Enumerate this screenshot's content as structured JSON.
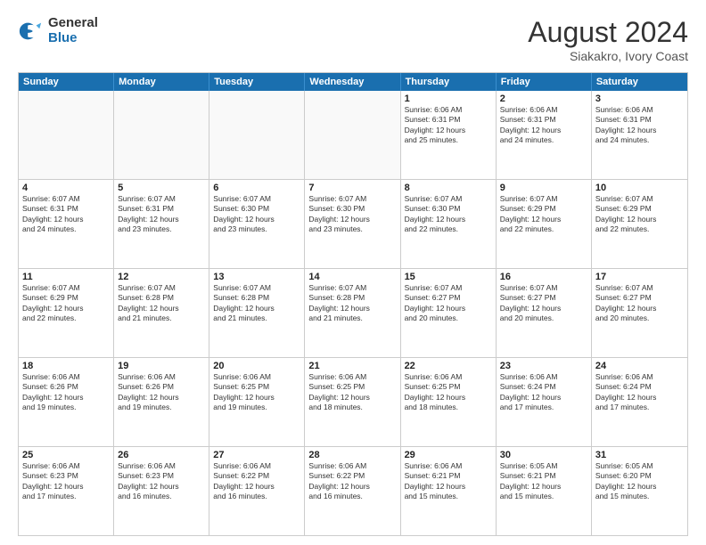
{
  "logo": {
    "general": "General",
    "blue": "Blue"
  },
  "title": {
    "month_year": "August 2024",
    "location": "Siakakro, Ivory Coast"
  },
  "weekdays": [
    "Sunday",
    "Monday",
    "Tuesday",
    "Wednesday",
    "Thursday",
    "Friday",
    "Saturday"
  ],
  "weeks": [
    [
      {
        "day": "",
        "text": ""
      },
      {
        "day": "",
        "text": ""
      },
      {
        "day": "",
        "text": ""
      },
      {
        "day": "",
        "text": ""
      },
      {
        "day": "1",
        "text": "Sunrise: 6:06 AM\nSunset: 6:31 PM\nDaylight: 12 hours\nand 25 minutes."
      },
      {
        "day": "2",
        "text": "Sunrise: 6:06 AM\nSunset: 6:31 PM\nDaylight: 12 hours\nand 24 minutes."
      },
      {
        "day": "3",
        "text": "Sunrise: 6:06 AM\nSunset: 6:31 PM\nDaylight: 12 hours\nand 24 minutes."
      }
    ],
    [
      {
        "day": "4",
        "text": "Sunrise: 6:07 AM\nSunset: 6:31 PM\nDaylight: 12 hours\nand 24 minutes."
      },
      {
        "day": "5",
        "text": "Sunrise: 6:07 AM\nSunset: 6:31 PM\nDaylight: 12 hours\nand 23 minutes."
      },
      {
        "day": "6",
        "text": "Sunrise: 6:07 AM\nSunset: 6:30 PM\nDaylight: 12 hours\nand 23 minutes."
      },
      {
        "day": "7",
        "text": "Sunrise: 6:07 AM\nSunset: 6:30 PM\nDaylight: 12 hours\nand 23 minutes."
      },
      {
        "day": "8",
        "text": "Sunrise: 6:07 AM\nSunset: 6:30 PM\nDaylight: 12 hours\nand 22 minutes."
      },
      {
        "day": "9",
        "text": "Sunrise: 6:07 AM\nSunset: 6:29 PM\nDaylight: 12 hours\nand 22 minutes."
      },
      {
        "day": "10",
        "text": "Sunrise: 6:07 AM\nSunset: 6:29 PM\nDaylight: 12 hours\nand 22 minutes."
      }
    ],
    [
      {
        "day": "11",
        "text": "Sunrise: 6:07 AM\nSunset: 6:29 PM\nDaylight: 12 hours\nand 22 minutes."
      },
      {
        "day": "12",
        "text": "Sunrise: 6:07 AM\nSunset: 6:28 PM\nDaylight: 12 hours\nand 21 minutes."
      },
      {
        "day": "13",
        "text": "Sunrise: 6:07 AM\nSunset: 6:28 PM\nDaylight: 12 hours\nand 21 minutes."
      },
      {
        "day": "14",
        "text": "Sunrise: 6:07 AM\nSunset: 6:28 PM\nDaylight: 12 hours\nand 21 minutes."
      },
      {
        "day": "15",
        "text": "Sunrise: 6:07 AM\nSunset: 6:27 PM\nDaylight: 12 hours\nand 20 minutes."
      },
      {
        "day": "16",
        "text": "Sunrise: 6:07 AM\nSunset: 6:27 PM\nDaylight: 12 hours\nand 20 minutes."
      },
      {
        "day": "17",
        "text": "Sunrise: 6:07 AM\nSunset: 6:27 PM\nDaylight: 12 hours\nand 20 minutes."
      }
    ],
    [
      {
        "day": "18",
        "text": "Sunrise: 6:06 AM\nSunset: 6:26 PM\nDaylight: 12 hours\nand 19 minutes."
      },
      {
        "day": "19",
        "text": "Sunrise: 6:06 AM\nSunset: 6:26 PM\nDaylight: 12 hours\nand 19 minutes."
      },
      {
        "day": "20",
        "text": "Sunrise: 6:06 AM\nSunset: 6:25 PM\nDaylight: 12 hours\nand 19 minutes."
      },
      {
        "day": "21",
        "text": "Sunrise: 6:06 AM\nSunset: 6:25 PM\nDaylight: 12 hours\nand 18 minutes."
      },
      {
        "day": "22",
        "text": "Sunrise: 6:06 AM\nSunset: 6:25 PM\nDaylight: 12 hours\nand 18 minutes."
      },
      {
        "day": "23",
        "text": "Sunrise: 6:06 AM\nSunset: 6:24 PM\nDaylight: 12 hours\nand 17 minutes."
      },
      {
        "day": "24",
        "text": "Sunrise: 6:06 AM\nSunset: 6:24 PM\nDaylight: 12 hours\nand 17 minutes."
      }
    ],
    [
      {
        "day": "25",
        "text": "Sunrise: 6:06 AM\nSunset: 6:23 PM\nDaylight: 12 hours\nand 17 minutes."
      },
      {
        "day": "26",
        "text": "Sunrise: 6:06 AM\nSunset: 6:23 PM\nDaylight: 12 hours\nand 16 minutes."
      },
      {
        "day": "27",
        "text": "Sunrise: 6:06 AM\nSunset: 6:22 PM\nDaylight: 12 hours\nand 16 minutes."
      },
      {
        "day": "28",
        "text": "Sunrise: 6:06 AM\nSunset: 6:22 PM\nDaylight: 12 hours\nand 16 minutes."
      },
      {
        "day": "29",
        "text": "Sunrise: 6:06 AM\nSunset: 6:21 PM\nDaylight: 12 hours\nand 15 minutes."
      },
      {
        "day": "30",
        "text": "Sunrise: 6:05 AM\nSunset: 6:21 PM\nDaylight: 12 hours\nand 15 minutes."
      },
      {
        "day": "31",
        "text": "Sunrise: 6:05 AM\nSunset: 6:20 PM\nDaylight: 12 hours\nand 15 minutes."
      }
    ]
  ]
}
